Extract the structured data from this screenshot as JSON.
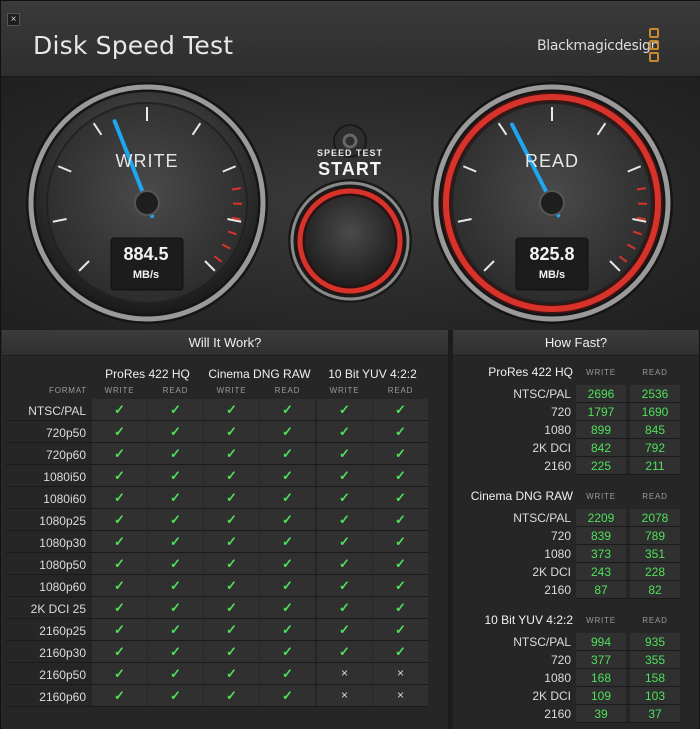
{
  "title": "Disk Speed Test",
  "brand": "Blackmagicdesign",
  "close_glyph": "×",
  "gauges": {
    "write": {
      "label": "WRITE",
      "value": "884.5",
      "unit": "MB/s",
      "needle_fraction": 0.42
    },
    "read": {
      "label": "READ",
      "value": "825.8",
      "unit": "MB/s",
      "needle_fraction": 0.4
    }
  },
  "start": {
    "line1": "SPEED TEST",
    "line2": "START"
  },
  "settings_icon": "gear-icon",
  "will_it_work": {
    "title": "Will It Work?",
    "format_label": "FORMAT",
    "codecs": [
      "ProRes 422 HQ",
      "Cinema DNG RAW",
      "10 Bit YUV 4:2:2"
    ],
    "sub_write": "WRITE",
    "sub_read": "READ",
    "rows": [
      {
        "format": "NTSC/PAL",
        "results": [
          1,
          1,
          1,
          1,
          1,
          1
        ]
      },
      {
        "format": "720p50",
        "results": [
          1,
          1,
          1,
          1,
          1,
          1
        ]
      },
      {
        "format": "720p60",
        "results": [
          1,
          1,
          1,
          1,
          1,
          1
        ]
      },
      {
        "format": "1080i50",
        "results": [
          1,
          1,
          1,
          1,
          1,
          1
        ]
      },
      {
        "format": "1080i60",
        "results": [
          1,
          1,
          1,
          1,
          1,
          1
        ]
      },
      {
        "format": "1080p25",
        "results": [
          1,
          1,
          1,
          1,
          1,
          1
        ]
      },
      {
        "format": "1080p30",
        "results": [
          1,
          1,
          1,
          1,
          1,
          1
        ]
      },
      {
        "format": "1080p50",
        "results": [
          1,
          1,
          1,
          1,
          1,
          1
        ]
      },
      {
        "format": "1080p60",
        "results": [
          1,
          1,
          1,
          1,
          1,
          1
        ]
      },
      {
        "format": "2K DCI 25",
        "results": [
          1,
          1,
          1,
          1,
          1,
          1
        ]
      },
      {
        "format": "2160p25",
        "results": [
          1,
          1,
          1,
          1,
          1,
          1
        ]
      },
      {
        "format": "2160p30",
        "results": [
          1,
          1,
          1,
          1,
          1,
          1
        ]
      },
      {
        "format": "2160p50",
        "results": [
          1,
          1,
          1,
          1,
          0,
          0
        ]
      },
      {
        "format": "2160p60",
        "results": [
          1,
          1,
          1,
          1,
          0,
          0
        ]
      }
    ],
    "check_glyph": "✓",
    "cross_glyph": "×"
  },
  "how_fast": {
    "title": "How Fast?",
    "sub_write": "WRITE",
    "sub_read": "READ",
    "groups": [
      {
        "codec": "ProRes 422 HQ",
        "rows": [
          {
            "label": "NTSC/PAL",
            "write": "2696",
            "read": "2536"
          },
          {
            "label": "720",
            "write": "1797",
            "read": "1690"
          },
          {
            "label": "1080",
            "write": "899",
            "read": "845"
          },
          {
            "label": "2K DCI",
            "write": "842",
            "read": "792"
          },
          {
            "label": "2160",
            "write": "225",
            "read": "211"
          }
        ]
      },
      {
        "codec": "Cinema DNG RAW",
        "rows": [
          {
            "label": "NTSC/PAL",
            "write": "2209",
            "read": "2078"
          },
          {
            "label": "720",
            "write": "839",
            "read": "789"
          },
          {
            "label": "1080",
            "write": "373",
            "read": "351"
          },
          {
            "label": "2K DCI",
            "write": "243",
            "read": "228"
          },
          {
            "label": "2160",
            "write": "87",
            "read": "82"
          }
        ]
      },
      {
        "codec": "10 Bit YUV 4:2:2",
        "rows": [
          {
            "label": "NTSC/PAL",
            "write": "994",
            "read": "935"
          },
          {
            "label": "720",
            "write": "377",
            "read": "355"
          },
          {
            "label": "1080",
            "write": "168",
            "read": "158"
          },
          {
            "label": "2K DCI",
            "write": "109",
            "read": "103"
          },
          {
            "label": "2160",
            "write": "39",
            "read": "37"
          }
        ]
      }
    ]
  },
  "colors": {
    "check": "#4fe05a",
    "needle": "#1ea6f0",
    "read_ring": "#d8332b",
    "brand_logo": "#c88a2a"
  }
}
